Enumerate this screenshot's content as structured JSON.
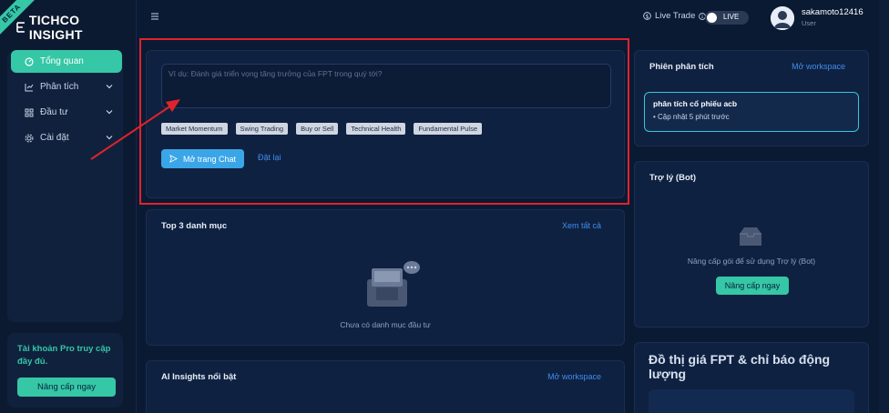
{
  "brand": {
    "name": "TICHCO INSIGHT",
    "badge": "BETA"
  },
  "sidebar": {
    "items": [
      {
        "label": "Tổng quan",
        "icon": "dashboard-icon",
        "active": true
      },
      {
        "label": "Phân tích",
        "icon": "chart-icon",
        "expandable": true
      },
      {
        "label": "Đầu tư",
        "icon": "grid-icon",
        "expandable": true
      },
      {
        "label": "Cài đặt",
        "icon": "gear-icon",
        "expandable": true
      }
    ],
    "pro": {
      "text": "Tài khoản Pro truy cập đầy đủ.",
      "button": "Nâng cấp ngay"
    }
  },
  "header": {
    "live_trade_label": "Live Trade",
    "toggle_label": "LIVE",
    "user": {
      "name": "sakamoto12416",
      "role": "User"
    }
  },
  "chat": {
    "placeholder": "Ví dụ: Đánh giá triển vọng tăng trưởng của FPT trong quý tới?",
    "chips": [
      "Market Momentum",
      "Swing Trading",
      "Buy or Sell",
      "Technical Health",
      "Fundamental Pulse"
    ],
    "open_button": "Mở trang Chat",
    "reset_link": "Đặt lại"
  },
  "top3": {
    "title": "Top 3 danh mục",
    "link": "Xem tất cả",
    "empty": "Chưa có danh mục đầu tư"
  },
  "insights": {
    "title": "AI Insights nổi bật",
    "link": "Mở workspace"
  },
  "session": {
    "title": "Phiên phân tích",
    "link": "Mở workspace",
    "item": {
      "title": "phân tích cổ phiếu acb",
      "subtitle": "• Cập nhật 5 phút trước"
    }
  },
  "bot": {
    "title": "Trợ lý (Bot)",
    "text": "Nâng cấp gói để sử dụng Trợ lý (Bot)",
    "button": "Nâng cấp ngay"
  },
  "chart_card": {
    "title": "Đồ thị giá FPT & chỉ báo động lượng"
  },
  "colors": {
    "accent": "#35c7a6",
    "link": "#3e8ef0",
    "highlight": "#e0232b",
    "background": "#0b1a33"
  }
}
